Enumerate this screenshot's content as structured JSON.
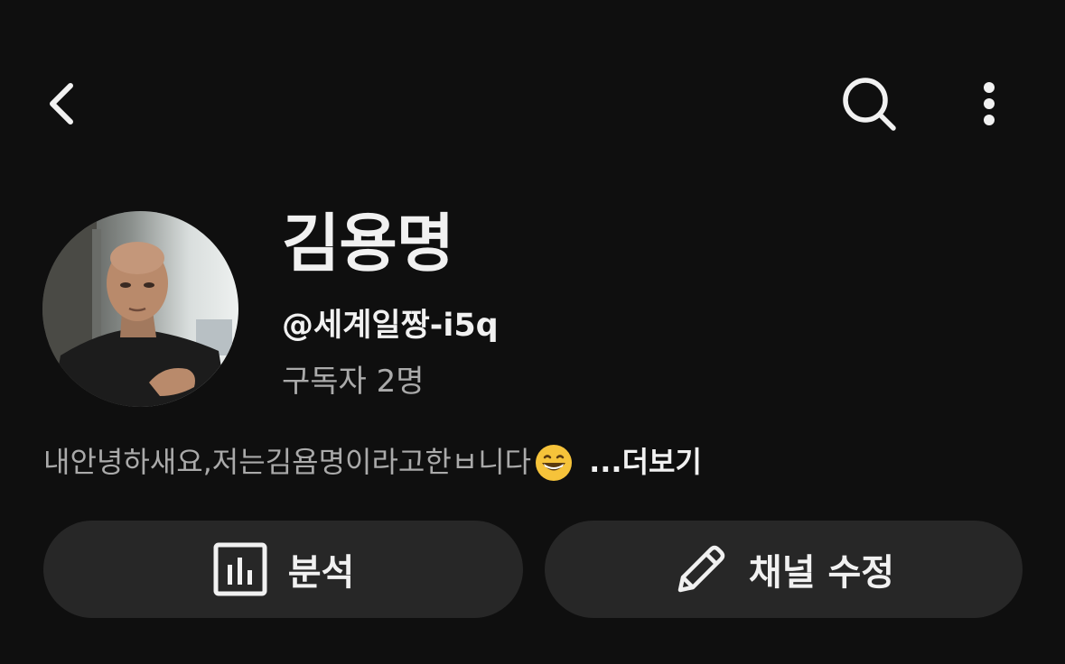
{
  "topbar": {
    "back_icon": "chevron-left-icon",
    "search_icon": "search-icon",
    "more_icon": "more-vertical-icon"
  },
  "profile": {
    "name": "김용명",
    "handle": "@세계일짱-i5q",
    "subscribers": "구독자 2명",
    "description": "내안녕하새요,저는김욤명이라고한ㅂ니다",
    "description_emoji": "grinning-face-icon",
    "more_label": "...더보기"
  },
  "actions": {
    "analytics_label": "분석",
    "analytics_icon": "analytics-icon",
    "edit_label": "채널 수정",
    "edit_icon": "pencil-icon"
  },
  "colors": {
    "background": "#0f0f0f",
    "button_bg": "#272727",
    "primary_text": "#f1f1f1",
    "secondary_text": "#aaaaaa"
  }
}
